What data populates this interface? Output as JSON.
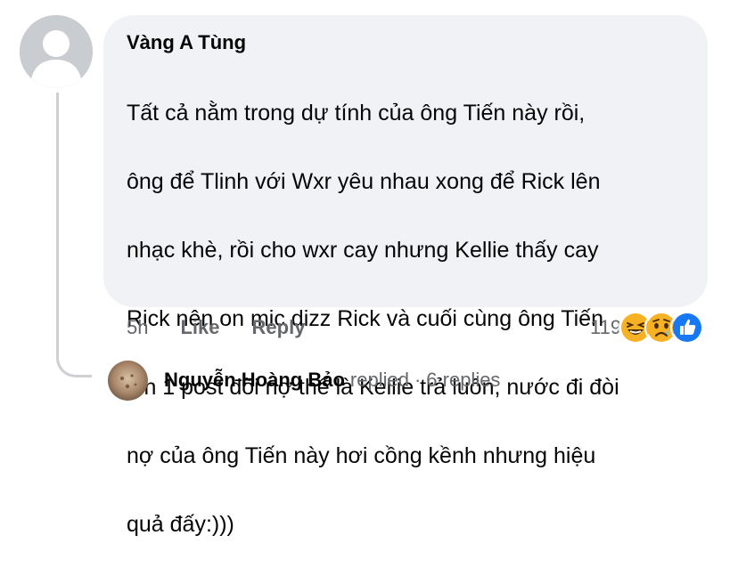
{
  "comment": {
    "author": "Vàng A Tùng",
    "lines": [
      "Tất cả nằm trong dự tính của ông Tiến này rồi,",
      "ông để Tlinh với Wxr yêu nhau xong để Rick lên",
      "nhạc khè, rồi cho wxr cay nhưng Kellie thấy cay",
      "Rick nên on mic dizz Rick và cuối cùng ông Tiến",
      "lên 1 post đòi nợ thế là Kellie trả luôn, nước đi đòi",
      "nợ của ông Tiến này hơi cồng kềnh nhưng hiệu",
      "quả đấy:)))"
    ]
  },
  "actions": {
    "time": "5h",
    "like": "Like",
    "reply": "Reply"
  },
  "reactions": {
    "count": "119",
    "icons": [
      "laughing-emoji",
      "sad-emoji",
      "like-emoji"
    ],
    "colors": {
      "like": "#1877f2",
      "emoji": "#f7b125"
    }
  },
  "reply_summary": {
    "name": "Nguyễn Hoàng Bảo",
    "action": "replied",
    "separator": "·",
    "count": "6 replies"
  }
}
